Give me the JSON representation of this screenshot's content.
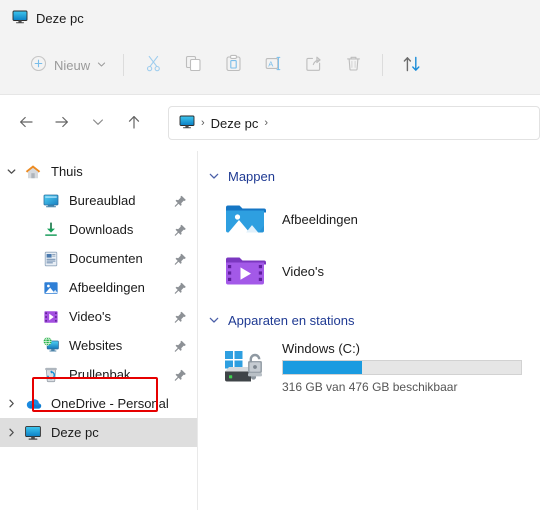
{
  "window": {
    "tab_title": "Deze pc",
    "tab_icon": "this-pc-monitor-icon"
  },
  "toolbar": {
    "new_label": "Nieuw",
    "new_icon": "plus-circle-icon",
    "new_chevron_icon": "chevron-down-icon",
    "buttons": [
      {
        "name": "cut-button",
        "icon": "scissors-icon",
        "label": "Knippen"
      },
      {
        "name": "copy-button",
        "icon": "copy-icon",
        "label": "Kopiëren"
      },
      {
        "name": "paste-button",
        "icon": "paste-icon",
        "label": "Plakken"
      },
      {
        "name": "rename-button",
        "icon": "rename-icon",
        "label": "Naam wijzigen"
      },
      {
        "name": "share-button",
        "icon": "share-icon",
        "label": "Delen"
      },
      {
        "name": "delete-button",
        "icon": "trash-icon",
        "label": "Verwijderen"
      },
      {
        "name": "sort-button",
        "icon": "sort-arrows-icon",
        "label": "Sorteren"
      }
    ]
  },
  "address": {
    "back_icon": "arrow-left-icon",
    "forward_icon": "arrow-right-icon",
    "recent_icon": "chevron-down-icon",
    "up_icon": "arrow-up-icon",
    "crumb_icon": "this-pc-monitor-icon",
    "crumb_label": "Deze pc",
    "crumb_sep": "›"
  },
  "sidebar": {
    "items": [
      {
        "label": "Thuis",
        "icon": "home-icon",
        "level": 0,
        "chevron": "expanded",
        "pinned": false,
        "selected": false,
        "highlighted": false
      },
      {
        "label": "Bureaublad",
        "icon": "desktop-icon",
        "level": 1,
        "chevron": "none",
        "pinned": true,
        "selected": false,
        "highlighted": false
      },
      {
        "label": "Downloads",
        "icon": "downloads-icon",
        "level": 1,
        "chevron": "none",
        "pinned": true,
        "selected": false,
        "highlighted": false
      },
      {
        "label": "Documenten",
        "icon": "documents-icon",
        "level": 1,
        "chevron": "none",
        "pinned": true,
        "selected": false,
        "highlighted": false
      },
      {
        "label": "Afbeeldingen",
        "icon": "pictures-icon",
        "level": 1,
        "chevron": "none",
        "pinned": true,
        "selected": false,
        "highlighted": false
      },
      {
        "label": "Video's",
        "icon": "videos-icon",
        "level": 1,
        "chevron": "none",
        "pinned": true,
        "selected": false,
        "highlighted": false
      },
      {
        "label": "Websites",
        "icon": "websites-icon",
        "level": 1,
        "chevron": "none",
        "pinned": true,
        "selected": false,
        "highlighted": false
      },
      {
        "label": "Prullenbak",
        "icon": "recycle-bin-icon",
        "level": 1,
        "chevron": "none",
        "pinned": true,
        "selected": false,
        "highlighted": true
      },
      {
        "label": "OneDrive - Personal",
        "icon": "onedrive-icon",
        "level": 0,
        "chevron": "collapsed",
        "pinned": false,
        "selected": false,
        "highlighted": false
      },
      {
        "label": "Deze pc",
        "icon": "this-pc-monitor-icon",
        "level": 0,
        "chevron": "collapsed",
        "pinned": false,
        "selected": true,
        "highlighted": false
      }
    ],
    "highlight_color": "#e60000"
  },
  "content": {
    "groups": [
      {
        "title": "Mappen",
        "chevron": "expanded",
        "items": [
          {
            "name": "Afbeeldingen",
            "icon": "pictures-folder-icon"
          },
          {
            "name": "Video's",
            "icon": "videos-folder-icon"
          }
        ]
      },
      {
        "title": "Apparaten en stations",
        "chevron": "expanded",
        "drives": [
          {
            "name": "Windows (C:)",
            "icon": "windows-drive-icon",
            "capacity_text": "316 GB van 476 GB beschikbaar",
            "free_gb": 316,
            "total_gb": 476,
            "used_percent": 33
          }
        ]
      }
    ],
    "accent_color": "#1f3a93",
    "meter_fill_color": "#1a9be0"
  }
}
